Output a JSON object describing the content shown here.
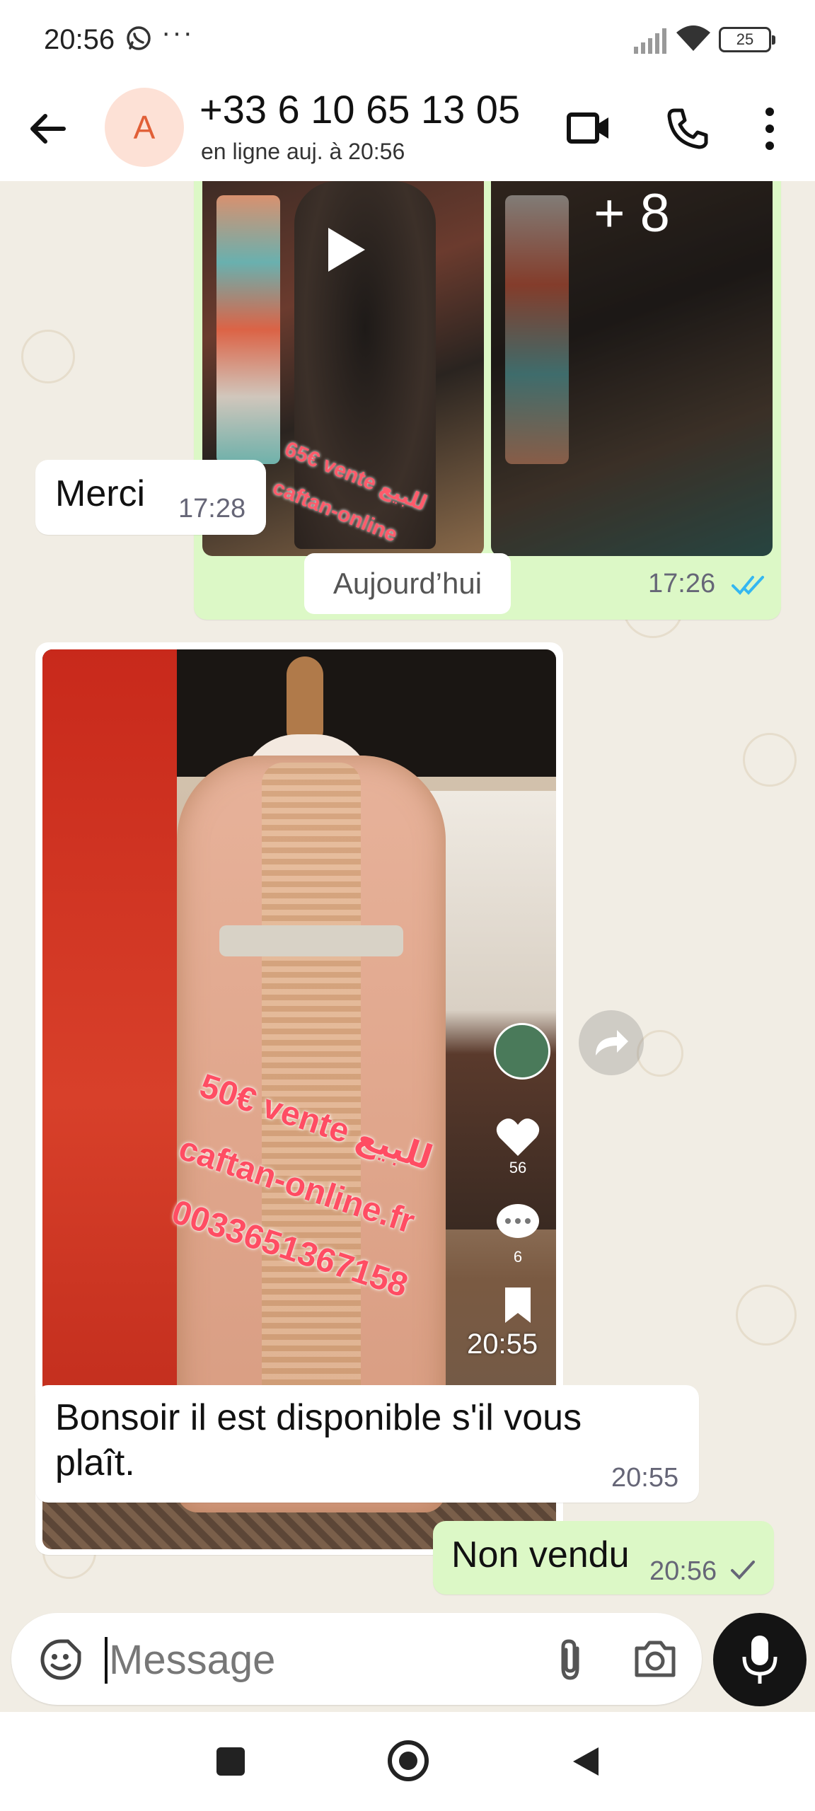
{
  "status_bar": {
    "time": "20:56",
    "overflow": "···",
    "battery": "25",
    "icons": [
      "whatsapp-icon",
      "signal-icon",
      "wifi-icon",
      "battery-icon"
    ]
  },
  "header": {
    "avatar_letter": "A",
    "contact_name": "+33 6 10 65 13 05",
    "contact_status": "en ligne auj. à 20:56",
    "icons": [
      "back-arrow-icon",
      "video-call-icon",
      "phone-icon",
      "more-vert-icon"
    ]
  },
  "chat": {
    "album": {
      "more_count": "+ 8",
      "overlay_text_1": "65€ vente للبيع",
      "overlay_text_2": "caftan-online",
      "time": "17:26",
      "status": "read"
    },
    "incoming_1": {
      "text": "Merci",
      "time": "17:28"
    },
    "date_separator": "Aujourd’hui",
    "shared_video": {
      "overlay_price": "50€ vente للبيع",
      "overlay_site": "caftan-online.fr",
      "overlay_phone": "0033651367158",
      "likes": "56",
      "comments": "6",
      "time": "20:55"
    },
    "incoming_2": {
      "text": "Bonsoir  il est disponible  s'il vous plaît.",
      "time": "20:55"
    },
    "outgoing_last": {
      "text": "Non vendu",
      "time": "20:56",
      "status": "sent"
    }
  },
  "composer": {
    "placeholder": "Message",
    "icons": [
      "emoji-icon",
      "attach-icon",
      "camera-icon",
      "mic-icon"
    ]
  },
  "colors": {
    "chat_background": "#f1ede4",
    "outgoing_bubble": "#dcf8c6",
    "incoming_bubble": "#ffffff",
    "read_ticks": "#34b7f1",
    "avatar_bg": "#fde1d6",
    "avatar_fg": "#e15f37"
  }
}
